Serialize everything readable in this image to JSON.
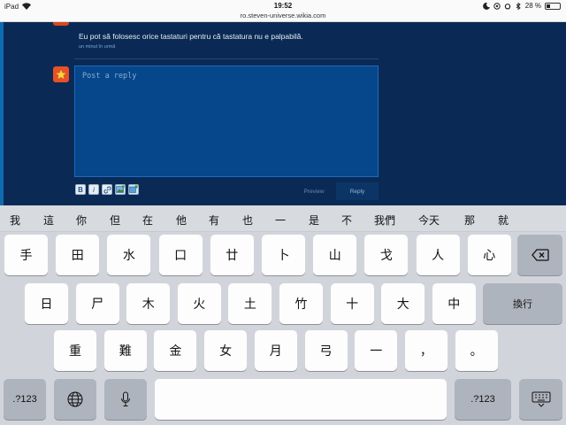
{
  "status_bar": {
    "device": "iPad",
    "time": "19:52",
    "url": "ro.steven-universe.wikia.com",
    "battery": "28 %",
    "battery_level": 0.28
  },
  "comment": {
    "text": "Eu pot să folosesc orice tastaturi pentru că tastatura nu e palpabilă.",
    "time": "un minut în urmă"
  },
  "reply": {
    "placeholder": "Post a reply",
    "toolbar": {
      "bold": "B",
      "italic": "i",
      "link": "link-icon",
      "image": "image-icon",
      "video": "video-icon"
    },
    "preview_label": "Preview",
    "reply_label": "Reply"
  },
  "keyboard": {
    "candidates": [
      "我",
      "這",
      "你",
      "但",
      "在",
      "他",
      "有",
      "也",
      "一",
      "是",
      "不",
      "我們",
      "今天",
      "那",
      "就"
    ],
    "row1": [
      "手",
      "田",
      "水",
      "口",
      "廿",
      "卜",
      "山",
      "戈",
      "人",
      "心"
    ],
    "row2": [
      "日",
      "尸",
      "木",
      "火",
      "土",
      "竹",
      "十",
      "大",
      "中"
    ],
    "row3": [
      "重",
      "難",
      "金",
      "女",
      "月",
      "弓",
      "一",
      "，",
      "。"
    ],
    "return_label": "換行",
    "numbers_label": ".?123",
    "globe": "globe-icon",
    "mic": "mic-icon",
    "hide": "keyboard-hide-icon",
    "delete": "delete-icon"
  }
}
